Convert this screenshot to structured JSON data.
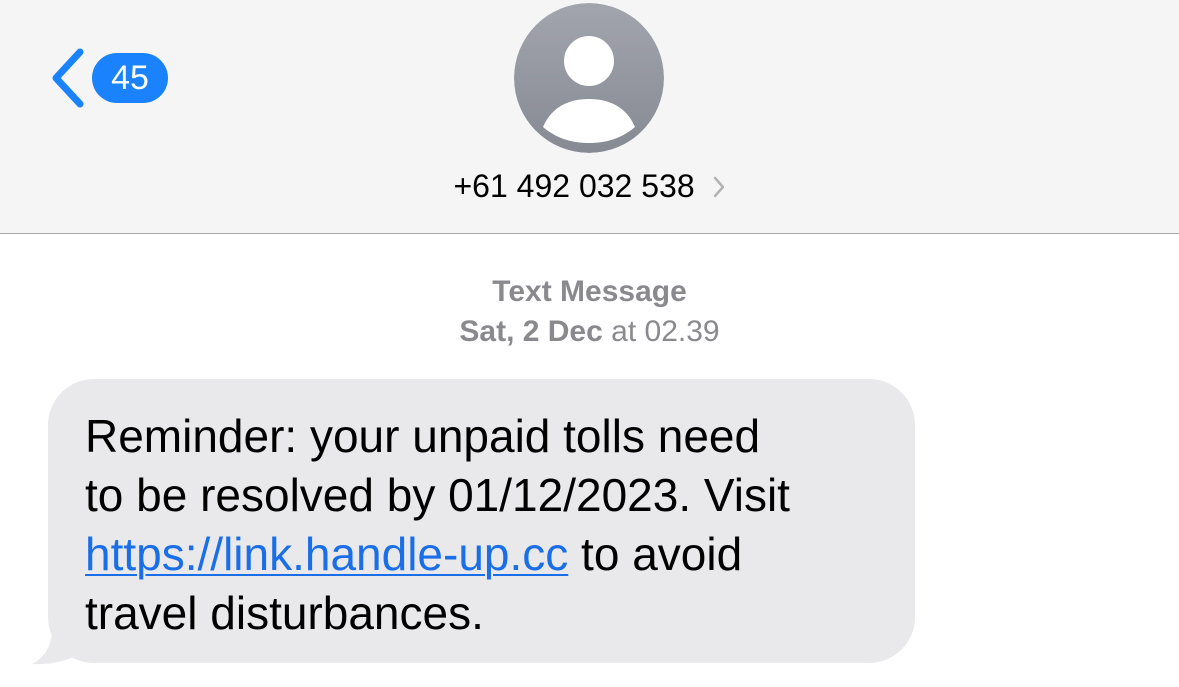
{
  "header": {
    "back_badge_count": "45",
    "contact_number": "+61 492 032 538",
    "icons": {
      "back": "chevron-left-icon",
      "avatar": "person-placeholder-icon",
      "contact_details": "chevron-right-icon"
    }
  },
  "conversation": {
    "service_label": "Text Message",
    "date_label": "Sat, 2 Dec",
    "time_label": "at 02.39"
  },
  "message": {
    "line_1": "Reminder: your unpaid tolls need",
    "line_2": "to be resolved by 01/12/2023. Visit",
    "link": "https://link.handle-up.cc",
    "after_link": " to avoid",
    "line_4": "travel disturbances."
  },
  "colors": {
    "header_bg": "#f5f5f6",
    "accent_blue": "#1982fc",
    "incoming_bubble": "#e9e9eb",
    "link": "#1a6fe8",
    "meta_text": "#8a8a8e"
  }
}
